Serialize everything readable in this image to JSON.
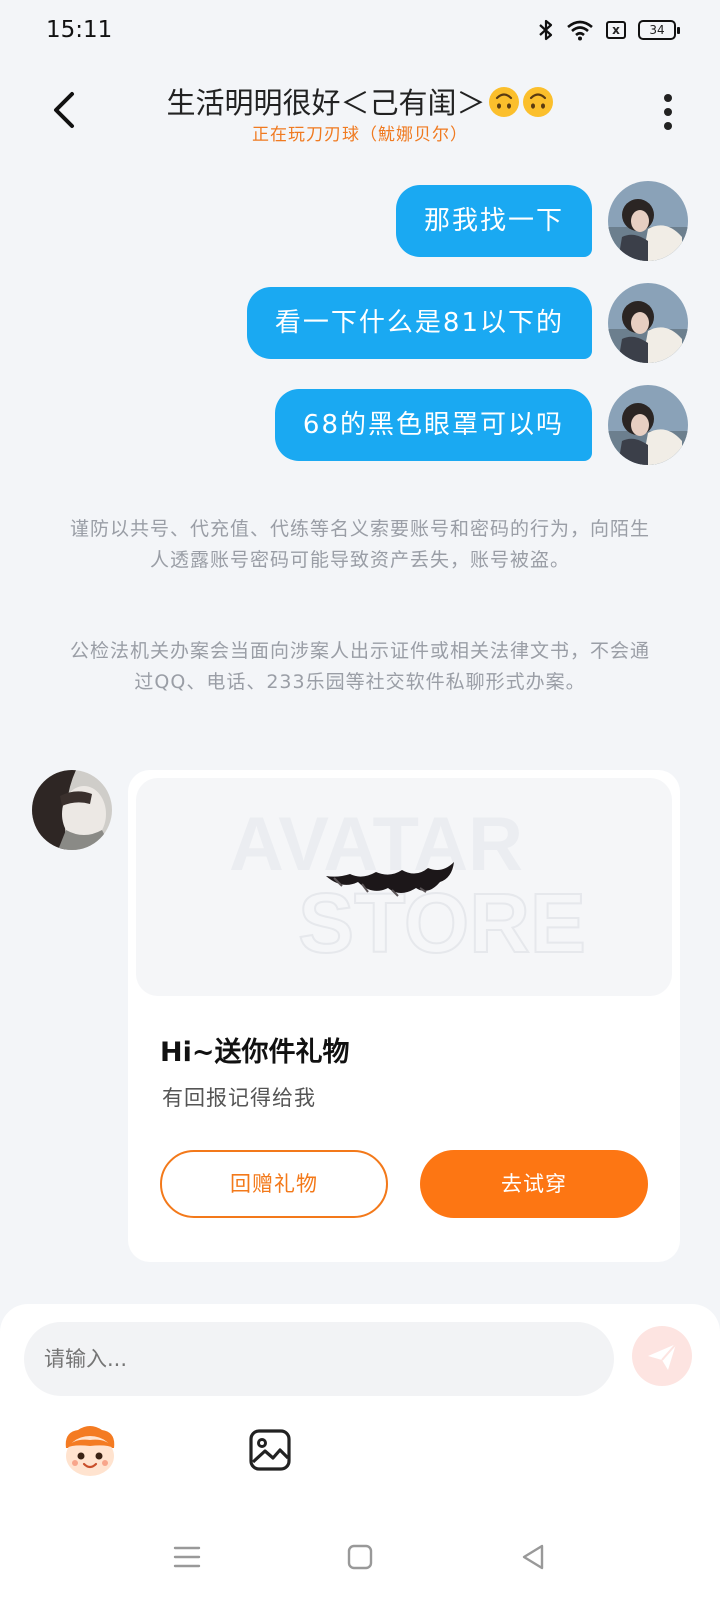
{
  "status": {
    "time": "15:11",
    "battery": "34",
    "sim_icon": "x"
  },
  "header": {
    "title": "生活明明很好＜己有闺＞",
    "subtitle": "正在玩刀刃球（魷娜贝尔）"
  },
  "messages": [
    {
      "text": "那我找一下"
    },
    {
      "text": "看一下什么是81以下的"
    },
    {
      "text": "68的黑色眼罩可以吗"
    }
  ],
  "notices": [
    "谨防以共号、代充值、代练等名义索要账号和密码的行为，向陌生人透露账号密码可能导致资产丢失，账号被盗。",
    "公检法机关办案会当面向涉案人出示证件或相关法律文书，不会通过QQ、电话、233乐园等社交软件私聊形式办案。"
  ],
  "gift_card": {
    "watermark_line1": "AVATAR",
    "watermark_line2": "STORE",
    "title": "Hi~送你件礼物",
    "subtitle": "有回报记得给我",
    "return_gift_label": "回赠礼物",
    "try_on_label": "去试穿"
  },
  "input": {
    "placeholder": "请输入..."
  },
  "colors": {
    "bubble": "#1aa9f2",
    "accent_orange": "#fd7613",
    "subtitle_orange": "#f07a20"
  }
}
